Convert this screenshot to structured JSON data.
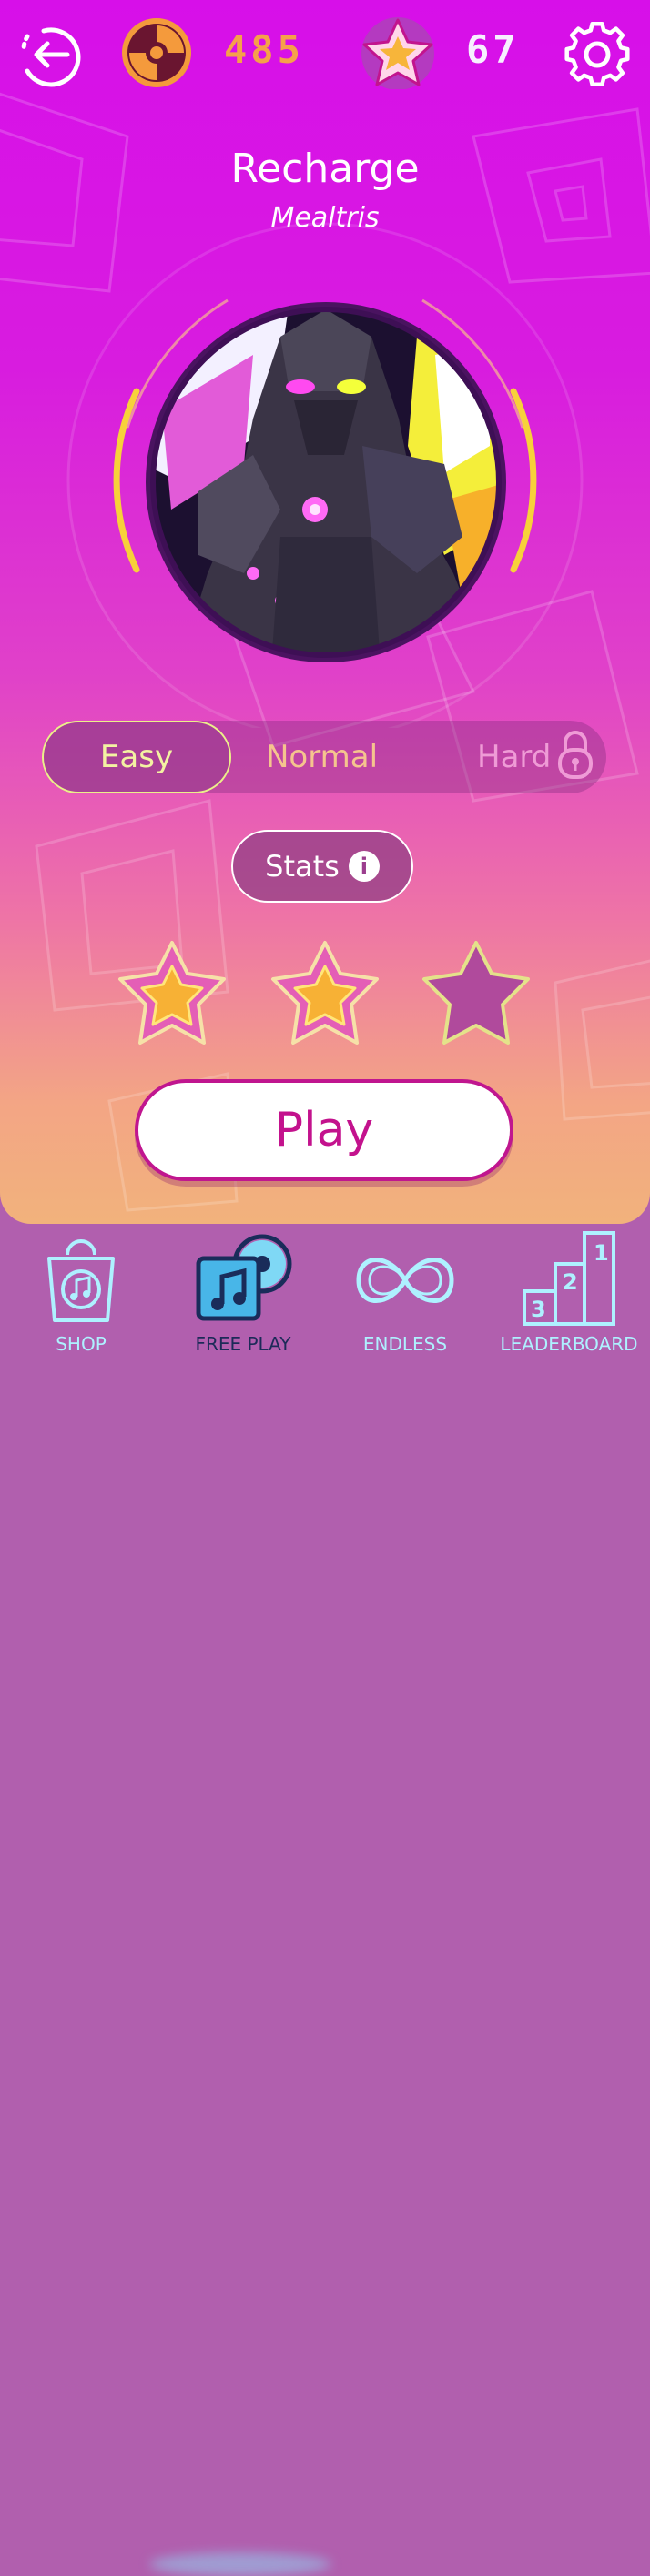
{
  "header": {
    "coins": "485",
    "stars": "67",
    "back_icon": "back-arrow-icon",
    "coin_icon": "vinyl-disc-icon",
    "star_icon": "star-icon",
    "settings_icon": "gear-icon"
  },
  "song": {
    "title": "Recharge",
    "artist": "Mealtris"
  },
  "difficulty": {
    "options": [
      "Easy",
      "Normal",
      "Hard"
    ],
    "selected": "Easy",
    "locked": "Hard"
  },
  "stats_label": "Stats",
  "rating": {
    "earned": 2,
    "total": 3
  },
  "play_label": "Play",
  "nav": {
    "items": [
      {
        "label": "SHOP",
        "icon": "shopping-bag-music-icon"
      },
      {
        "label": "FREE PLAY",
        "icon": "music-note-disc-icon"
      },
      {
        "label": "ENDLESS",
        "icon": "infinity-icon"
      },
      {
        "label": "LEADERBOARD",
        "icon": "podium-icon"
      }
    ],
    "active": "FREE PLAY"
  },
  "colors": {
    "bg_top": "#d70fe9",
    "bg_bottom": "#f2b27c",
    "coin_text": "#f5a04a",
    "accent_yellow": "#f7e03a",
    "play_text": "#c3128d",
    "nav_text": "#aef1ff"
  }
}
